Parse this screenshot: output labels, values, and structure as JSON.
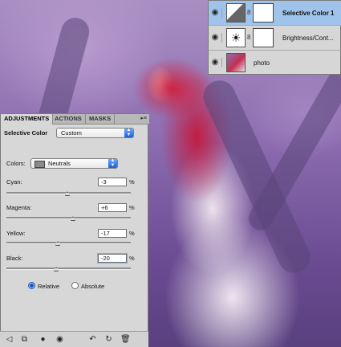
{
  "layers": [
    {
      "name": "Selective Color 1",
      "icon": "selective-color-icon",
      "selected": true
    },
    {
      "name": "Brightness/Cont...",
      "icon": "brightness-contrast-icon",
      "selected": false
    },
    {
      "name": "photo",
      "icon": "photo-thumbnail",
      "selected": false
    }
  ],
  "adjustments": {
    "tabs": [
      "ADJUSTMENTS",
      "ACTIONS",
      "MASKS"
    ],
    "active_tab": "ADJUSTMENTS",
    "panel_title": "Selective Color",
    "preset": "Custom",
    "colors_label": "Colors:",
    "colors_value": "Neutrals",
    "sliders": [
      {
        "label": "Cyan:",
        "value": "-3",
        "unit": "%",
        "level": -3
      },
      {
        "label": "Magenta:",
        "value": "+6",
        "unit": "%",
        "level": 6
      },
      {
        "label": "Yellow:",
        "value": "-17",
        "unit": "%",
        "level": -17
      },
      {
        "label": "Black:",
        "value": "-20",
        "unit": "%",
        "level": -20
      }
    ],
    "method": {
      "relative": "Relative",
      "absolute": "Absolute",
      "selected": "Relative"
    }
  },
  "colors": {
    "selection": "#9fc3ea",
    "panel": "#d7d7d7",
    "accent": "#1f5fd6"
  }
}
